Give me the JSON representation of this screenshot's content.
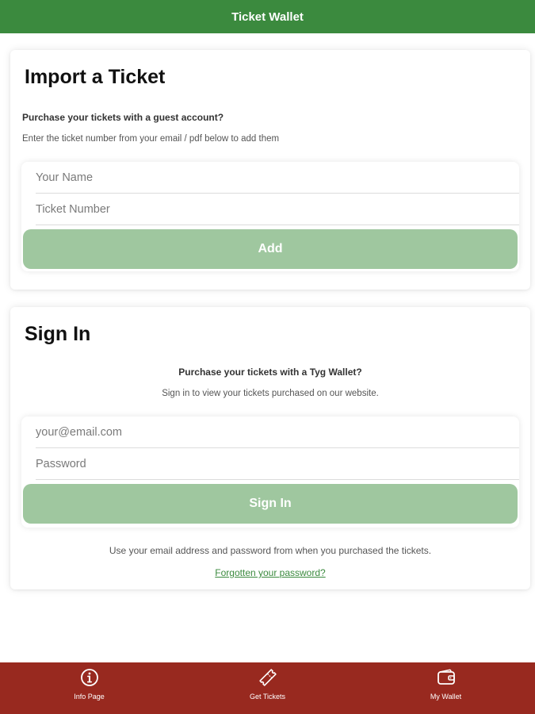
{
  "header": {
    "title": "Ticket Wallet"
  },
  "import_card": {
    "title": "Import a Ticket",
    "subhead": "Purchase your tickets with a guest account?",
    "description": "Enter the ticket number from your email / pdf below to add them",
    "name_placeholder": "Your Name",
    "ticket_placeholder": "Ticket Number",
    "add_label": "Add"
  },
  "signin_card": {
    "title": "Sign In",
    "subhead": "Purchase your tickets with a Tyg Wallet?",
    "description": "Sign in to view your tickets purchased on our website.",
    "email_placeholder": "your@email.com",
    "password_placeholder": "Password",
    "signin_label": "Sign In",
    "help_text": "Use your email address and password from when you purchased the tickets.",
    "forgot_link": "Forgotten your password?"
  },
  "bottom_nav": {
    "items": [
      {
        "label": "Info Page",
        "icon": "info-icon"
      },
      {
        "label": "Get Tickets",
        "icon": "ticket-icon"
      },
      {
        "label": "My Wallet",
        "icon": "wallet-icon"
      }
    ]
  },
  "colors": {
    "header_green": "#3b8a3e",
    "button_green": "#9fc79f",
    "nav_red": "#98291f",
    "link_green": "#3b8a3e"
  }
}
